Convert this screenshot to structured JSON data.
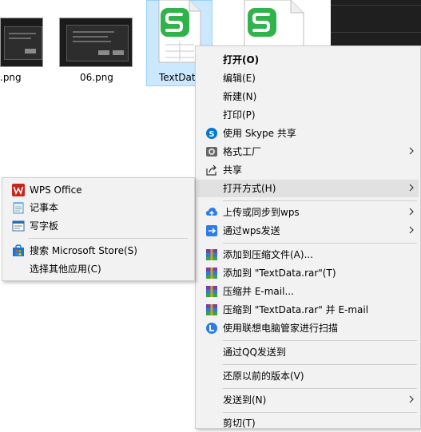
{
  "files": [
    {
      "name": ".png"
    },
    {
      "name": "06.png"
    },
    {
      "name": "TextDat"
    }
  ],
  "context_menu": {
    "items": [
      {
        "label": "打开(O)",
        "icon": "none"
      },
      {
        "label": "编辑(E)",
        "icon": "none"
      },
      {
        "label": "新建(N)",
        "icon": "none"
      },
      {
        "label": "打印(P)",
        "icon": "none"
      },
      {
        "label": "使用 Skype 共享",
        "icon": "skype-icon"
      },
      {
        "label": "格式工厂",
        "icon": "format-factory-icon"
      },
      {
        "label": "共享",
        "icon": "share-icon"
      },
      {
        "label": "打开方式(H)",
        "icon": "none"
      },
      {
        "label": "上传或同步到wps",
        "icon": "cloud-upload-icon"
      },
      {
        "label": "通过wps发送",
        "icon": "send-arrow-icon"
      },
      {
        "label": "添加到压缩文件(A)...",
        "icon": "winrar-icon"
      },
      {
        "label": "添加到 \"TextData.rar\"(T)",
        "icon": "winrar-icon"
      },
      {
        "label": "压缩并 E-mail...",
        "icon": "winrar-icon"
      },
      {
        "label": "压缩到 \"TextData.rar\" 并 E-mail",
        "icon": "winrar-icon"
      },
      {
        "label": "使用联想电脑管家进行扫描",
        "icon": "lenovo-scan-icon"
      },
      {
        "label": "通过QQ发送到",
        "icon": "none"
      },
      {
        "label": "还原以前的版本(V)",
        "icon": "none"
      },
      {
        "label": "发送到(N)",
        "icon": "none"
      },
      {
        "label": "剪切(T)",
        "icon": "none"
      }
    ]
  },
  "open_with_submenu": {
    "items": [
      {
        "label": "WPS Office",
        "icon": "wps-office-icon"
      },
      {
        "label": "记事本",
        "icon": "notepad-icon"
      },
      {
        "label": "写字板",
        "icon": "wordpad-icon"
      },
      {
        "label": "搜索 Microsoft Store(S)",
        "icon": "microsoft-store-icon"
      },
      {
        "label": "选择其他应用(C)",
        "icon": "none"
      }
    ]
  },
  "colors": {
    "wps_green": "#2fb34a",
    "selection": "#cce8ff",
    "menu_bg": "#f2f2f2",
    "highlight": "#e1e1e1"
  }
}
